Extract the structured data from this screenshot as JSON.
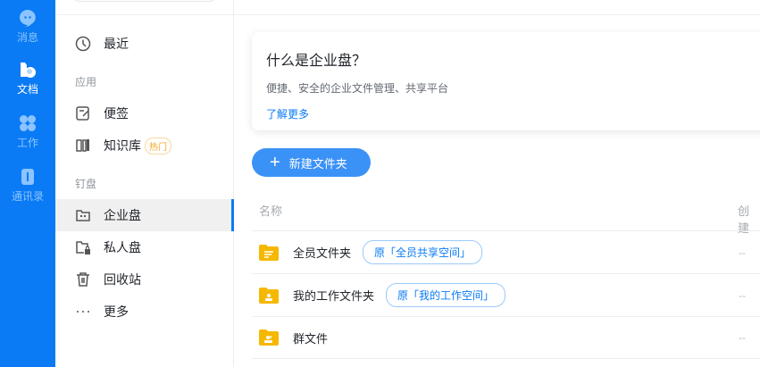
{
  "rail": [
    {
      "label": "消息"
    },
    {
      "label": "文档"
    },
    {
      "label": "工作"
    },
    {
      "label": "通讯录"
    }
  ],
  "sidebar": {
    "recent": "最近",
    "apps_section": "应用",
    "notes": "便签",
    "wiki": "知识库",
    "wiki_badge": "热门",
    "pinned_section": "钉盘",
    "enterprise": "企业盘",
    "private": "私人盘",
    "trash": "回收站",
    "more": "更多"
  },
  "card": {
    "title": "什么是企业盘？",
    "desc": "便捷、安全的企业文件管理、共享平台",
    "link": "了解更多"
  },
  "new_folder": "新建文件夹",
  "table": {
    "col_name": "名称",
    "col_created": "创建",
    "rows": [
      {
        "name": "全员文件夹",
        "tag": "原「全员共享空间」",
        "created": "--"
      },
      {
        "name": "我的工作文件夹",
        "tag": "原「我的工作空间」",
        "created": "--"
      },
      {
        "name": "群文件",
        "created": "--"
      }
    ]
  },
  "colors": {
    "accent": "#0a7bf5",
    "folder": "#f5b800"
  }
}
